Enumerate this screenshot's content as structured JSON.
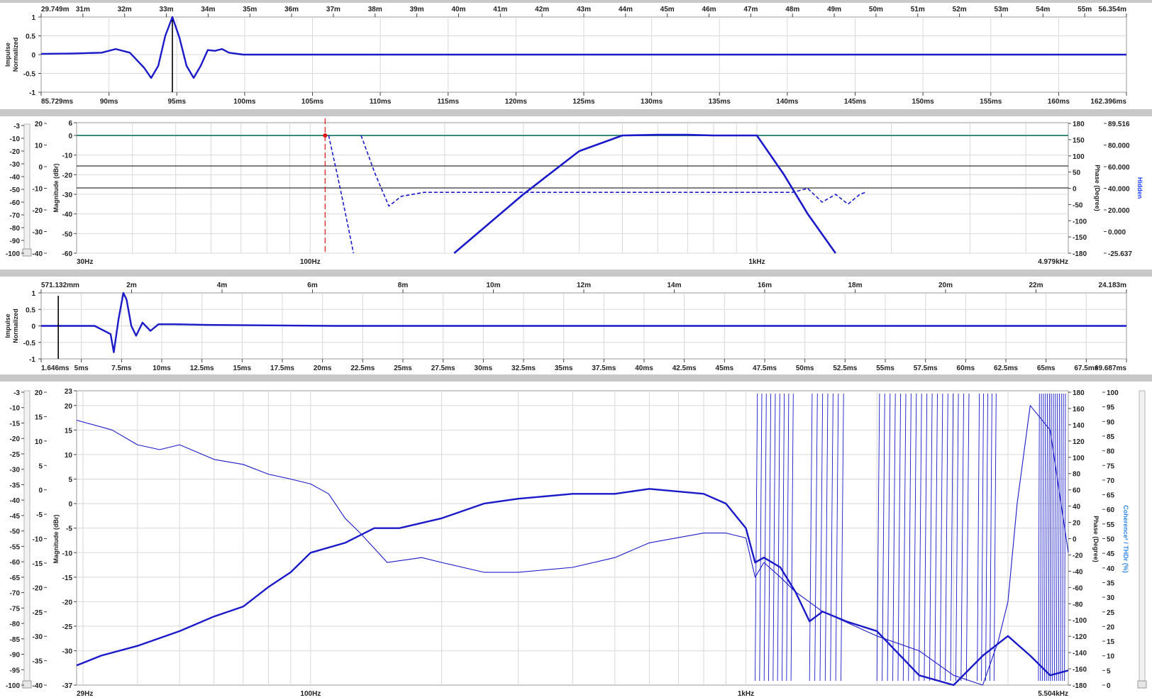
{
  "colors": {
    "trace": "#1a1ac8",
    "grid": "#d8d8d8",
    "separator": "#c8c8c8",
    "reference_line": "#000000",
    "marker_red": "#e01010",
    "coherence_label": "#2f86e8"
  },
  "panel1": {
    "ylabel": "Impulse\nNormalized",
    "top_axis": [
      "29.749m",
      "31m",
      "32m",
      "33m",
      "34m",
      "35m",
      "36m",
      "37m",
      "38m",
      "39m",
      "40m",
      "41m",
      "42m",
      "43m",
      "44m",
      "45m",
      "46m",
      "47m",
      "48m",
      "49m",
      "50m",
      "51m",
      "52m",
      "53m",
      "54m",
      "55m",
      "56.354m"
    ],
    "bottom_axis": [
      "85.729ms",
      "90ms",
      "95ms",
      "100ms",
      "105ms",
      "110ms",
      "115ms",
      "120ms",
      "125ms",
      "130ms",
      "135ms",
      "140ms",
      "145ms",
      "150ms",
      "155ms",
      "160ms",
      "162.396ms"
    ],
    "y_ticks": [
      "1",
      "0.5",
      "0",
      "-0.5",
      "-1"
    ]
  },
  "panel2": {
    "ylabel": "Magnitude (dBr)",
    "y2label": "Phase (Degree)",
    "hidden_label": "Hidden",
    "slider_ticks": [
      "-3",
      "-10",
      "-20",
      "-30",
      "-40",
      "-50",
      "-60",
      "-70",
      "-80",
      "-90",
      "-100"
    ],
    "y_outer_ticks": [
      "20",
      "10",
      "0",
      "-10",
      "-20",
      "-30",
      "-40"
    ],
    "y_mag_ticks": [
      "6",
      "0",
      "-10",
      "-20",
      "-30",
      "-40",
      "-50",
      "-60"
    ],
    "phase_ticks": [
      "180",
      "150",
      "100",
      "50",
      "0",
      "-50",
      "-100",
      "-150",
      "-180"
    ],
    "hidden_ticks": [
      "89.516",
      "80.000",
      "60.000",
      "40.000",
      "20.000",
      "0.000",
      "-25.637"
    ],
    "x_ticks": [
      "30Hz",
      "100Hz",
      "1kHz",
      "4.979kHz"
    ]
  },
  "panel3": {
    "ylabel": "Impulse\nNormalized",
    "top_axis": [
      "571.132mm",
      "2m",
      "4m",
      "6m",
      "8m",
      "10m",
      "12m",
      "14m",
      "16m",
      "18m",
      "20m",
      "22m",
      "24.183m"
    ],
    "bottom_axis": [
      "1.646ms",
      "5ms",
      "7.5ms",
      "10ms",
      "12.5ms",
      "15ms",
      "17.5ms",
      "20ms",
      "22.5ms",
      "25ms",
      "27.5ms",
      "30ms",
      "32.5ms",
      "35ms",
      "37.5ms",
      "40ms",
      "42.5ms",
      "45ms",
      "47.5ms",
      "50ms",
      "52.5ms",
      "55ms",
      "57.5ms",
      "60ms",
      "62.5ms",
      "65ms",
      "67.5ms",
      "69.687ms"
    ],
    "y_ticks": [
      "1",
      "0.5",
      "0",
      "-0.5",
      "-1"
    ]
  },
  "panel4": {
    "ylabel": "Magnitude (dBr)",
    "y2label": "Phase (Degree)",
    "y3label": "Coherence² / THDr (%)",
    "slider_ticks": [
      "-3",
      "-10",
      "-15",
      "-20",
      "-25",
      "-30",
      "-35",
      "-40",
      "-45",
      "-50",
      "-55",
      "-60",
      "-65",
      "-70",
      "-75",
      "-80",
      "-85",
      "-90",
      "-95",
      "-100"
    ],
    "y_outer_ticks": [
      "20",
      "15",
      "10",
      "5",
      "0",
      "-5",
      "-10",
      "-15",
      "-20",
      "-25",
      "-30",
      "-35",
      "-40"
    ],
    "y_mag_ticks": [
      "23",
      "20",
      "15",
      "10",
      "5",
      "0",
      "-5",
      "-10",
      "-15",
      "-20",
      "-25",
      "-30",
      "-37"
    ],
    "phase_ticks": [
      "180",
      "160",
      "140",
      "120",
      "100",
      "80",
      "60",
      "40",
      "20",
      "0",
      "-20",
      "-40",
      "-60",
      "-80",
      "-100",
      "-120",
      "-140",
      "-160",
      "-180"
    ],
    "coh_ticks": [
      "100",
      "95",
      "90",
      "85",
      "80",
      "75",
      "70",
      "65",
      "60",
      "55",
      "50",
      "45",
      "40",
      "35",
      "30",
      "25",
      "20",
      "15",
      "10",
      "5",
      "0"
    ],
    "x_ticks": [
      "29Hz",
      "100Hz",
      "1kHz",
      "5.504kHz"
    ]
  },
  "chart_data": [
    {
      "type": "line",
      "panel": "impulse-1",
      "xlabel": "",
      "ylabel": "Impulse Normalized",
      "xlim": [
        85.729,
        162.396
      ],
      "ylim": [
        -1,
        1
      ],
      "peak_time_ms": 95,
      "series": [
        {
          "x": [
            85.729,
            88,
            90,
            91,
            92,
            93,
            93.5,
            94,
            94.5,
            95,
            95.5,
            96,
            96.5,
            97,
            97.5,
            98,
            98.5,
            99,
            100,
            110,
            130,
            160,
            162.396
          ],
          "y": [
            0.02,
            0.03,
            0.05,
            0.15,
            0.05,
            -0.35,
            -0.62,
            -0.3,
            0.5,
            1.0,
            0.45,
            -0.3,
            -0.62,
            -0.3,
            0.12,
            0.1,
            0.15,
            0.05,
            0.0,
            0.0,
            0.0,
            0.0,
            0.0
          ]
        }
      ]
    },
    {
      "type": "line",
      "panel": "frequency-response-1",
      "xlabel": "",
      "ylabel": "Magnitude (dBr)",
      "y2label": "Phase (Degree)",
      "xlim": [
        30,
        4979
      ],
      "xscale": "log",
      "ylim": [
        -60,
        6
      ],
      "series": [
        {
          "x": [
            210,
            300,
            400,
            500,
            600,
            700,
            800,
            1000,
            1150,
            1300,
            1500
          ],
          "y": [
            -60,
            -30,
            -8,
            0,
            0.3,
            0.3,
            0,
            0,
            -20,
            -40,
            -60
          ]
        },
        {
          "x": [
            110,
            115,
            120,
            123,
            125
          ],
          "y": [
            0,
            -20,
            -40,
            -52,
            -60
          ]
        },
        {
          "x": [
            130,
            140,
            150,
            160,
            180,
            200,
            300,
            500,
            1000,
            1200,
            1300,
            1400,
            1500,
            1600,
            1700,
            1750
          ],
          "y": [
            0,
            -20,
            -36,
            -31,
            -29,
            -29,
            -29,
            -29,
            -29,
            -29,
            -27,
            -34,
            -30,
            -35,
            -30,
            -29
          ]
        }
      ]
    },
    {
      "type": "line",
      "panel": "impulse-2",
      "xlabel": "",
      "ylabel": "Impulse Normalized",
      "xlim": [
        1.646,
        69.687
      ],
      "ylim": [
        -1,
        1
      ],
      "series": [
        {
          "x": [
            1.646,
            3,
            5,
            6,
            6.2,
            6.5,
            6.8,
            7,
            7.3,
            7.6,
            8,
            8.5,
            9,
            10,
            12,
            20,
            40,
            69.687
          ],
          "y": [
            0,
            0,
            0,
            -0.25,
            -0.8,
            0.2,
            1.0,
            0.8,
            0.0,
            -0.3,
            0.1,
            -0.15,
            0.05,
            0.05,
            0.03,
            0.0,
            0.0,
            0.0
          ]
        }
      ]
    },
    {
      "type": "line",
      "panel": "frequency-response-2",
      "xlabel": "",
      "ylabel": "Magnitude (dBr)",
      "y2label": "Phase (Degree)",
      "y3label": "Coherence² / THDr (%)",
      "xlim": [
        29,
        5504
      ],
      "xscale": "log",
      "ylim": [
        -37,
        23
      ],
      "series": [
        {
          "x": [
            29,
            33,
            40,
            50,
            60,
            70,
            80,
            90,
            100,
            120,
            140,
            160,
            200,
            250,
            300,
            400,
            500,
            600,
            800,
            900,
            1000,
            1050,
            1100,
            1200,
            1300,
            1400,
            1500,
            1700,
            2000,
            2500,
            3000,
            3500,
            4000,
            4500,
            5000,
            5504
          ],
          "y": [
            -33,
            -31,
            -29,
            -26,
            -23,
            -21,
            -17,
            -14,
            -10,
            -8,
            -5,
            -5,
            -3,
            0,
            1,
            2,
            2,
            3,
            2,
            0,
            -5,
            -12,
            -11,
            -13,
            -18,
            -24,
            -22,
            -24,
            -26,
            -35,
            -37,
            -31,
            -27,
            -31,
            -35,
            -34
          ]
        },
        {
          "x": [
            29,
            35,
            40,
            45,
            50,
            60,
            70,
            80,
            90,
            100,
            110,
            120,
            130,
            150,
            180,
            200,
            250,
            300,
            400,
            500,
            600,
            800,
            900,
            1000,
            1050,
            1100,
            1200,
            1300,
            1500,
            2000,
            2500,
            3000,
            3500,
            3800,
            4000,
            4200,
            4500,
            5000,
            5504
          ],
          "y": [
            17,
            15,
            12,
            11,
            12,
            9,
            8,
            6,
            5,
            4,
            2,
            -3,
            -6,
            -12,
            -11,
            -12,
            -14,
            -14,
            -13,
            -11,
            -8,
            -6,
            -6,
            -7,
            -15,
            -12,
            -15,
            -18,
            -22,
            -27,
            -30,
            -35,
            -37,
            -28,
            -20,
            0,
            20,
            15,
            -10
          ]
        }
      ]
    }
  ]
}
